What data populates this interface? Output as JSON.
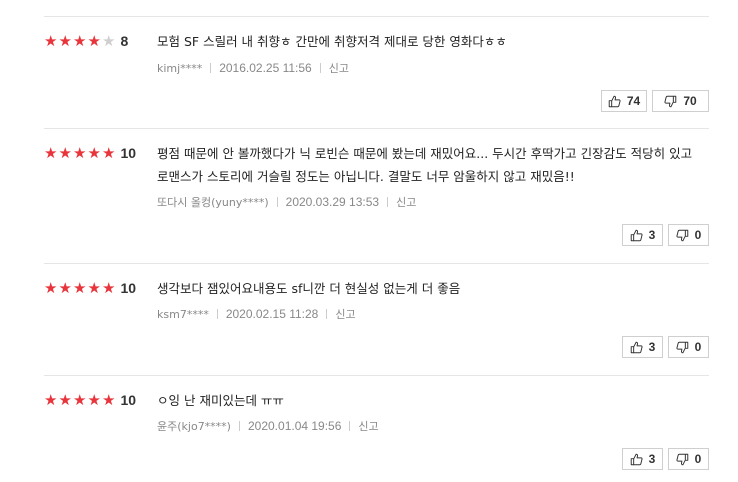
{
  "colors": {
    "star_on": "#e8353b",
    "star_off": "#cfcfcf"
  },
  "reviews": [
    {
      "stars": 4,
      "score": "8",
      "text": "모험 SF 스릴러 내 취향ㅎ 간만에 취향저격 제대로 당한 영화다ㅎㅎ",
      "author": "kimj****",
      "date": "2016.02.25 11:56",
      "report": "신고",
      "likes": "74",
      "dislikes": "70",
      "like_icon": "thumbs-up-icon",
      "dislike_icon": "thumbs-down-icon"
    },
    {
      "stars": 5,
      "score": "10",
      "text": "평점 때문에 안 볼까했다가 닉 로빈슨 때문에 봤는데 재밌어요... 두시간 후딱가고 긴장감도 적당히 있고 로맨스가 스토리에 거슬릴 정도는 아닙니다. 결말도 너무 암울하지 않고 재밌음!!",
      "author": "또다시 올컹(yuny****)",
      "date": "2020.03.29 13:53",
      "report": "신고",
      "likes": "3",
      "dislikes": "0",
      "like_icon": "thumbs-up-icon",
      "dislike_icon": "thumbs-down-icon"
    },
    {
      "stars": 5,
      "score": "10",
      "text": "생각보다 잼있어요내용도 sf니깐 더 현실성 없는게 더 좋음",
      "author": "ksm7****",
      "date": "2020.02.15 11:28",
      "report": "신고",
      "likes": "3",
      "dislikes": "0",
      "like_icon": "thumbs-up-icon",
      "dislike_icon": "thumbs-down-icon"
    },
    {
      "stars": 5,
      "score": "10",
      "text": "ㅇ잉 난 재미있는데 ㅠㅠ",
      "author": "윤주(kjo7****)",
      "date": "2020.01.04 19:56",
      "report": "신고",
      "likes": "3",
      "dislikes": "0",
      "like_icon": "thumbs-up-icon",
      "dislike_icon": "thumbs-down-icon"
    }
  ]
}
